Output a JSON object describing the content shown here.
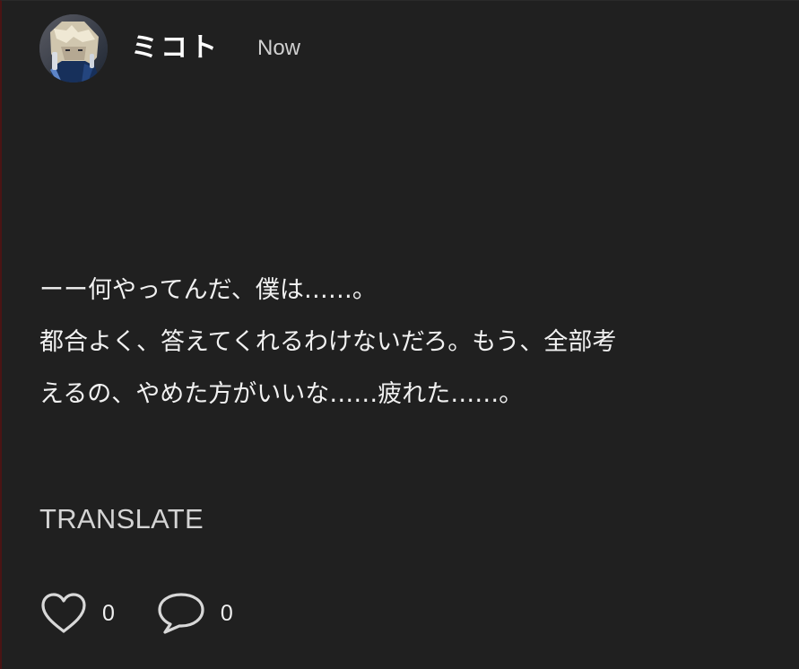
{
  "post": {
    "author": "ミコト",
    "timestamp": "Now",
    "lines": [
      "ーー何やってんだ、僕は……。",
      "都合よく、答えてくれるわけないだろ。もう、全部考",
      "えるの、やめた方がいいな……疲れた……。"
    ],
    "translate_label": "TRANSLATE",
    "like_count": "0",
    "comment_count": "0"
  },
  "colors": {
    "background": "#202020",
    "text": "#f1f1f1",
    "muted": "#d0d0d0",
    "icon_stroke": "#d8d8d8",
    "left_accent": "#4a1414"
  },
  "icons": {
    "like": "heart-outline-icon",
    "comment": "speech-bubble-outline-icon"
  }
}
